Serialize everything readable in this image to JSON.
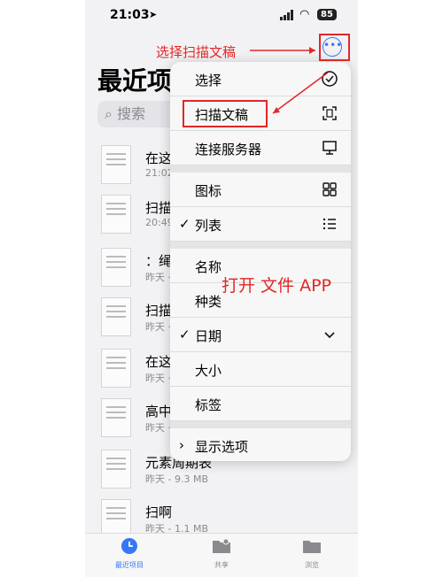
{
  "status_bar": {
    "time": "21:03",
    "battery": "85"
  },
  "header": {
    "title": "最近项",
    "more_glyph": "•••"
  },
  "search": {
    "placeholder": "搜索"
  },
  "annotations": {
    "select_scan": "选择扫描文稿",
    "open_files": "打开 文件 APP"
  },
  "files": [
    {
      "name": "在这",
      "meta": "21:02"
    },
    {
      "name": "扫描",
      "meta": "20:49"
    },
    {
      "name": "：绳",
      "meta": "昨天 · "
    },
    {
      "name": "扫描",
      "meta": "昨天 · "
    },
    {
      "name": "在这",
      "meta": "昨天 · "
    },
    {
      "name": "高中",
      "meta": "昨天 · "
    },
    {
      "name": "元素周期表",
      "meta": "昨天 - 9.3 MB"
    },
    {
      "name": "扫啊",
      "meta": "昨天 - 1.1 MB"
    }
  ],
  "menu": {
    "select": "选择",
    "scan_documents": "扫描文稿",
    "connect_server": "连接服务器",
    "icons": "图标",
    "list": "列表",
    "name": "名称",
    "kind": "种类",
    "date": "日期",
    "size": "大小",
    "tags": "标签",
    "view_options": "显示选项",
    "check_glyph": "✓",
    "expand_glyph": "›"
  },
  "tabs": [
    {
      "label": "最近项目",
      "icon": "clock-icon",
      "active": true
    },
    {
      "label": "共享",
      "icon": "shared-folder-icon",
      "active": false
    },
    {
      "label": "浏览",
      "icon": "folder-icon",
      "active": false
    }
  ],
  "colors": {
    "accent": "#3478f6",
    "annotation_red": "#e32626"
  }
}
